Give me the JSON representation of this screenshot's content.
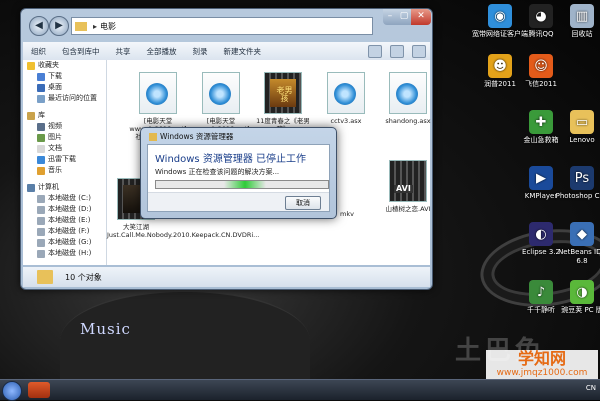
{
  "window": {
    "address_folder": "电影",
    "toolbar": [
      "组织",
      "包含到库中",
      "共享",
      "全部播放",
      "刻录",
      "新建文件夹"
    ],
    "nav": [
      {
        "label": "收藏夹",
        "header": true,
        "color": "#f0c030"
      },
      {
        "label": "下载",
        "header": false,
        "color": "#4a7fd4"
      },
      {
        "label": "桌面",
        "header": false,
        "color": "#3b6cb8"
      },
      {
        "label": "最近访问的位置",
        "header": false,
        "color": "#7aa0c8"
      },
      {
        "label": "库",
        "header": true,
        "color": "#c9a24b"
      },
      {
        "label": "视频",
        "header": false,
        "color": "#5a6f8a"
      },
      {
        "label": "图片",
        "header": false,
        "color": "#6a9a4a"
      },
      {
        "label": "文档",
        "header": false,
        "color": "#d8d8d8"
      },
      {
        "label": "迅雷下载",
        "header": false,
        "color": "#3a88d8"
      },
      {
        "label": "音乐",
        "header": false,
        "color": "#e0a030"
      },
      {
        "label": "计算机",
        "header": true,
        "color": "#5a7fa8"
      },
      {
        "label": "本地磁盘 (C:)",
        "header": false,
        "color": "#9aa8b8"
      },
      {
        "label": "本地磁盘 (D:)",
        "header": false,
        "color": "#9aa8b8"
      },
      {
        "label": "本地磁盘 (E:)",
        "header": false,
        "color": "#9aa8b8"
      },
      {
        "label": "本地磁盘 (F:)",
        "header": false,
        "color": "#9aa8b8"
      },
      {
        "label": "本地磁盘 (G:)",
        "header": false,
        "color": "#9aa8b8"
      },
      {
        "label": "本地磁盘 (H:)",
        "header": false,
        "color": "#9aa8b8"
      }
    ],
    "files": [
      {
        "label": "[电影天堂 www.dy2018.net]社拉拉升.rmvb"
      },
      {
        "label": "[电影天堂 www.dy2018.net]"
      },
      {
        "label": "11度青春之《老男孩》"
      },
      {
        "label": "cctv3.asx"
      },
      {
        "label": "shandong.asx"
      },
      {
        "label": "大笑江湖 Just.Call.Me.Nobody.2010.Keepack.CN.DVDRi..."
      },
      {
        "label": "mkv"
      },
      {
        "label": "山楂树之恋.AVI"
      }
    ],
    "status": "10 个对象",
    "avi_tag": "AVI",
    "film_caption": "老男孩"
  },
  "dialog": {
    "title": "Windows 资源管理器",
    "heading": "Windows 资源管理器 已停止工作",
    "message": "Windows 正在检查该问题的解决方案...",
    "cancel": "取消"
  },
  "desktop": {
    "icons": [
      {
        "label": "宽带网络证客户端",
        "color": "#2f8fdb",
        "glyph": "◉"
      },
      {
        "label": "腾讯QQ",
        "color": "#222",
        "glyph": "◕"
      },
      {
        "label": "回收站",
        "color": "#9fb3c9",
        "glyph": "▥"
      },
      {
        "label": "润普2011",
        "color": "#e3a21a",
        "glyph": "☻"
      },
      {
        "label": "飞信2011",
        "color": "#e35b1a",
        "glyph": "☺"
      },
      {
        "label": "金山急救箱",
        "color": "#3a9a3a",
        "glyph": "✚"
      },
      {
        "label": "Lenovo",
        "color": "#e8c15a",
        "glyph": "▭"
      },
      {
        "label": "KMPlayer",
        "color": "#1a4a9a",
        "glyph": "▶"
      },
      {
        "label": "Photoshop CS4",
        "color": "#1c3a6e",
        "glyph": "Ps"
      },
      {
        "label": "Eclipse 3.2",
        "color": "#2d2a6e",
        "glyph": "◐"
      },
      {
        "label": "NetBeans IDE 6.8",
        "color": "#3a6fb5",
        "glyph": "◆"
      },
      {
        "label": "千千静听",
        "color": "#3a8a3a",
        "glyph": "♪"
      },
      {
        "label": "豌豆荚 PC 版",
        "color": "#5ab83a",
        "glyph": "◑"
      }
    ],
    "music_text": "Music",
    "watermark": "土巴兔",
    "site_name": "学知网",
    "site_url": "www.jmqz1000.com"
  },
  "taskbar": {
    "tray_text": "CN"
  }
}
